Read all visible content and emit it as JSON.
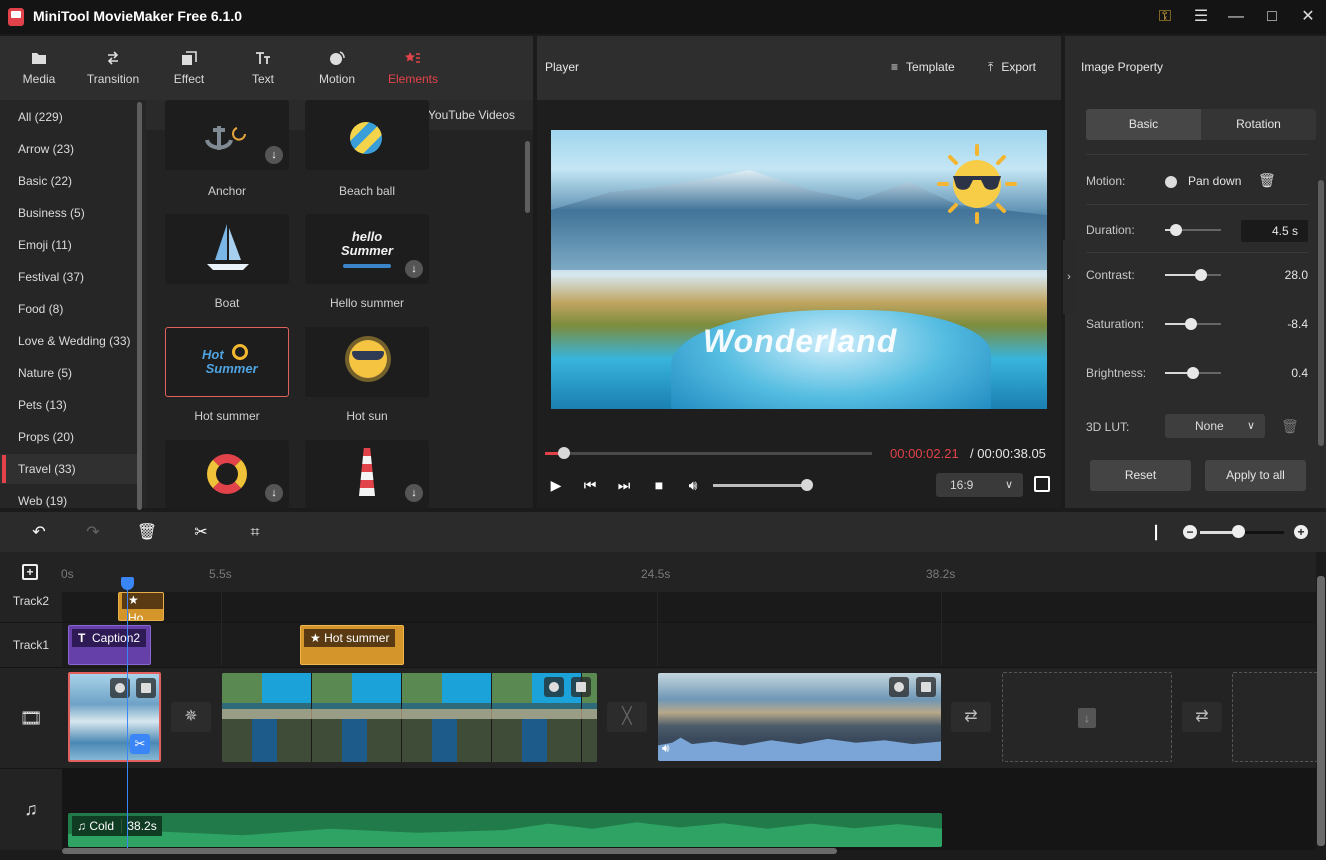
{
  "app": {
    "title": "MiniTool MovieMaker Free 6.1.0",
    "window_controls": [
      "key-icon",
      "menu-icon",
      "minimize-icon",
      "maximize-icon",
      "close-icon"
    ]
  },
  "nav": {
    "tabs": [
      {
        "label": "Media",
        "icon": "folder-icon",
        "active": false
      },
      {
        "label": "Transition",
        "icon": "transition-icon",
        "active": false
      },
      {
        "label": "Effect",
        "icon": "effect-icon",
        "active": false
      },
      {
        "label": "Text",
        "icon": "text-icon",
        "active": false
      },
      {
        "label": "Motion",
        "icon": "motion-icon",
        "active": false
      },
      {
        "label": "Elements",
        "icon": "elements-icon",
        "active": true
      }
    ]
  },
  "categories": [
    {
      "label": "All (229)"
    },
    {
      "label": "Arrow (23)"
    },
    {
      "label": "Basic (22)"
    },
    {
      "label": "Business (5)"
    },
    {
      "label": "Emoji (11)"
    },
    {
      "label": "Festival (37)"
    },
    {
      "label": "Food (8)"
    },
    {
      "label": "Love & Wedding (33)"
    },
    {
      "label": "Nature (5)"
    },
    {
      "label": "Pets (13)"
    },
    {
      "label": "Props (20)"
    },
    {
      "label": "Travel (33)",
      "active": true
    },
    {
      "label": "Web (19)"
    }
  ],
  "download_youtube": "Download YouTube Videos",
  "elements": [
    {
      "label": "Anchor",
      "downloadable": true
    },
    {
      "label": "Beach ball",
      "downloadable": false
    },
    {
      "label": "Boat",
      "downloadable": false
    },
    {
      "label": "Hello summer",
      "downloadable": true
    },
    {
      "label": "Hot summer",
      "downloadable": false,
      "selected": true
    },
    {
      "label": "Hot sun",
      "downloadable": false
    },
    {
      "label": "",
      "downloadable": true
    },
    {
      "label": "",
      "downloadable": true
    }
  ],
  "player": {
    "title": "Player",
    "template_label": "Template",
    "export_label": "Export",
    "overlay_text": "Wonderland",
    "time_current": "00:00:02.21",
    "time_total": "/ 00:00:38.05",
    "progress_fraction": 0.058,
    "volume_fraction": 1.0,
    "aspect_ratio": "16:9",
    "accent_color": "#e2434a"
  },
  "property": {
    "title": "Image Property",
    "tabs": [
      {
        "label": "Basic",
        "active": true
      },
      {
        "label": "Rotation",
        "active": false
      }
    ],
    "motion_label": "Motion:",
    "motion_value": "Pan down",
    "duration_label": "Duration:",
    "duration_value": "4.5 s",
    "duration_fraction": 0.2,
    "contrast_label": "Contrast:",
    "contrast_value": "28.0",
    "contrast_fraction": 0.64,
    "saturation_label": "Saturation:",
    "saturation_value": "-8.4",
    "saturation_fraction": 0.46,
    "brightness_label": "Brightness:",
    "brightness_value": "0.4",
    "brightness_fraction": 0.5,
    "lut_label": "3D LUT:",
    "lut_value": "None",
    "reset_label": "Reset",
    "apply_all_label": "Apply to all"
  },
  "timeline": {
    "zoom_fraction": 0.45,
    "ticks": [
      "0s",
      "5.5s",
      "24.5s",
      "38.2s"
    ],
    "tracks": {
      "track2_label": "Track2",
      "track1_label": "Track1"
    },
    "clips": {
      "track2_element": "Ho",
      "caption": "Caption2",
      "element": "Hot summer",
      "audio_name": "Cold",
      "audio_duration": "38.2s"
    }
  }
}
